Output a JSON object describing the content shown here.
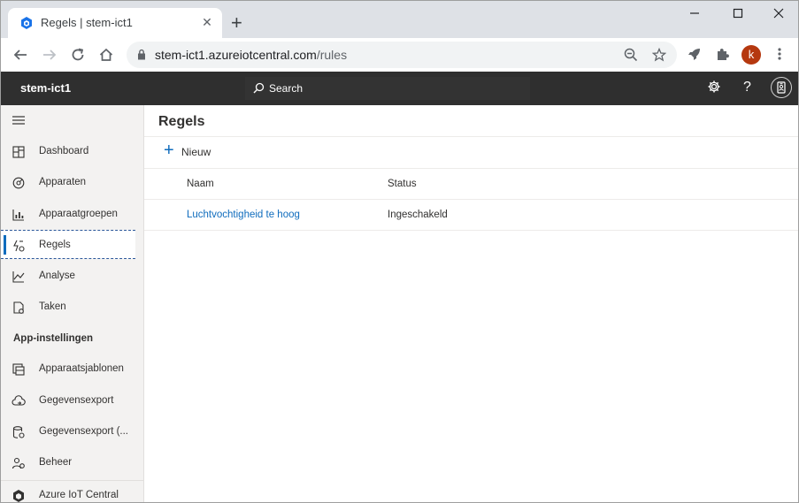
{
  "browser": {
    "tab_title": "Regels | stem-ict1",
    "url_host": "stem-ict1.azureiotcentral.com",
    "url_path": "/rules",
    "profile_initial": "k"
  },
  "app": {
    "name": "stem-ict1",
    "search_label": "Search"
  },
  "sidebar": {
    "items": [
      {
        "label": "Dashboard",
        "icon": "dashboard-icon"
      },
      {
        "label": "Apparaten",
        "icon": "devices-icon"
      },
      {
        "label": "Apparaatgroepen",
        "icon": "device-groups-icon"
      },
      {
        "label": "Regels",
        "icon": "rules-icon",
        "selected": true
      },
      {
        "label": "Analyse",
        "icon": "analytics-icon"
      },
      {
        "label": "Taken",
        "icon": "jobs-icon"
      }
    ],
    "section": "App-instellingen",
    "settings_items": [
      {
        "label": "Apparaatsjablonen",
        "icon": "device-templates-icon"
      },
      {
        "label": "Gegevensexport",
        "icon": "data-export-icon"
      },
      {
        "label": "Gegevensexport (...",
        "icon": "data-export-legacy-icon"
      },
      {
        "label": "Beheer",
        "icon": "administration-icon"
      }
    ],
    "footer": {
      "label": "Azure IoT Central",
      "icon": "iot-central-icon"
    }
  },
  "main": {
    "title": "Regels",
    "new_label": "Nieuw",
    "columns": [
      "Naam",
      "Status"
    ],
    "rows": [
      {
        "name": "Luchtvochtigheid te hoog",
        "status": "Ingeschakeld"
      }
    ]
  },
  "colors": {
    "accent": "#0f6cbd",
    "appbar": "#2f2f2f",
    "sidebar": "#f3f2f1"
  }
}
